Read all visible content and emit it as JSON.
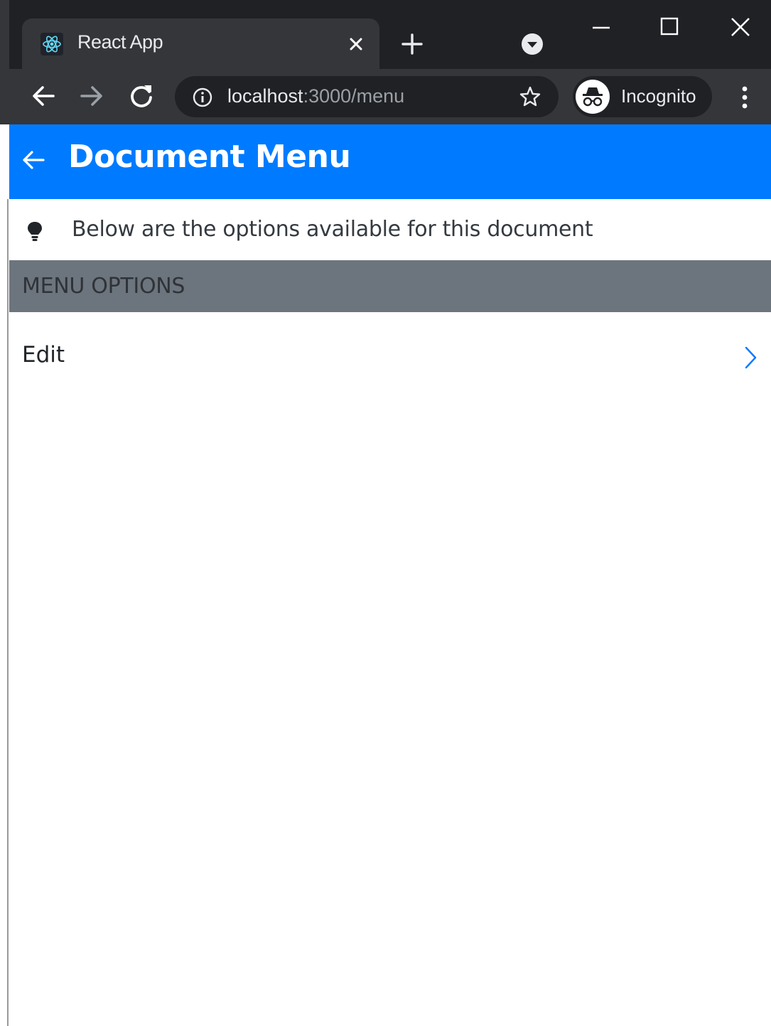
{
  "browser": {
    "tab_title": "React App",
    "url_host": "localhost",
    "url_path": ":3000/menu",
    "profile_label": "Incognito",
    "icons": [
      "react-favicon-icon",
      "close-icon",
      "plus-icon",
      "tab-search-icon",
      "minimize-icon",
      "maximize-icon",
      "window-close-icon",
      "back-icon",
      "forward-icon",
      "reload-icon",
      "info-icon",
      "star-icon",
      "incognito-icon",
      "more-vert-icon"
    ]
  },
  "header": {
    "title": "Document Menu",
    "back_icon": "arrow-left-icon",
    "color": "#007bff"
  },
  "info": {
    "icon": "lightbulb-icon",
    "text": "Below are the options available for this document"
  },
  "section": {
    "title": "MENU OPTIONS",
    "color": "#6c757d"
  },
  "menu": {
    "items": [
      {
        "label": "Edit",
        "icon": "chevron-right-icon"
      }
    ]
  }
}
